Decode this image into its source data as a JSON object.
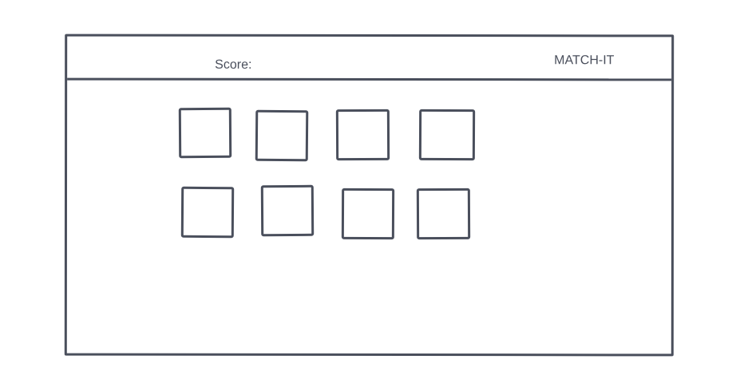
{
  "header": {
    "score_label": "Score:",
    "title": "MATCH-IT"
  },
  "board": {
    "rows": 2,
    "columns": 4,
    "cards": [
      {
        "id": 1,
        "state": "face-down"
      },
      {
        "id": 2,
        "state": "face-down"
      },
      {
        "id": 3,
        "state": "face-down"
      },
      {
        "id": 4,
        "state": "face-down"
      },
      {
        "id": 5,
        "state": "face-down"
      },
      {
        "id": 6,
        "state": "face-down"
      },
      {
        "id": 7,
        "state": "face-down"
      },
      {
        "id": 8,
        "state": "face-down"
      }
    ]
  },
  "colors": {
    "stroke": "#4a4f5c",
    "background": "#ffffff"
  }
}
